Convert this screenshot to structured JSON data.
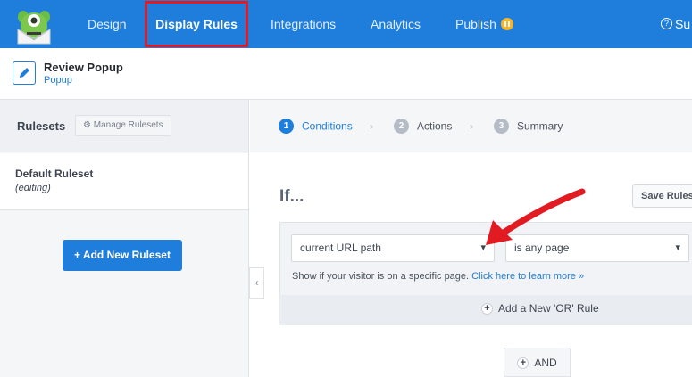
{
  "nav": {
    "items": [
      "Design",
      "Display Rules",
      "Integrations",
      "Analytics",
      "Publish"
    ],
    "active": "Display Rules",
    "support_label": "Su",
    "accent": "#1f7ddb",
    "highlight_color": "#e21b23"
  },
  "campaign": {
    "title": "Review Popup",
    "type": "Popup"
  },
  "sidebar": {
    "title": "Rulesets",
    "manage_label": "Manage Rulesets",
    "ruleset_name": "Default Ruleset",
    "ruleset_state": "(editing)",
    "add_label": "+ Add New Ruleset",
    "collapse_icon": "chevron-left-icon"
  },
  "steps": [
    {
      "num": "1",
      "label": "Conditions"
    },
    {
      "num": "2",
      "label": "Actions"
    },
    {
      "num": "3",
      "label": "Summary"
    }
  ],
  "main": {
    "if_label": "If...",
    "save_label": "Save Ruleset",
    "condition_field": "current URL path",
    "condition_operator": "is any page",
    "hint_text": "Show if your visitor is on a specific page.",
    "hint_link": "Click here to learn more »",
    "or_label": "Add a New 'OR' Rule",
    "and_label": "AND"
  }
}
